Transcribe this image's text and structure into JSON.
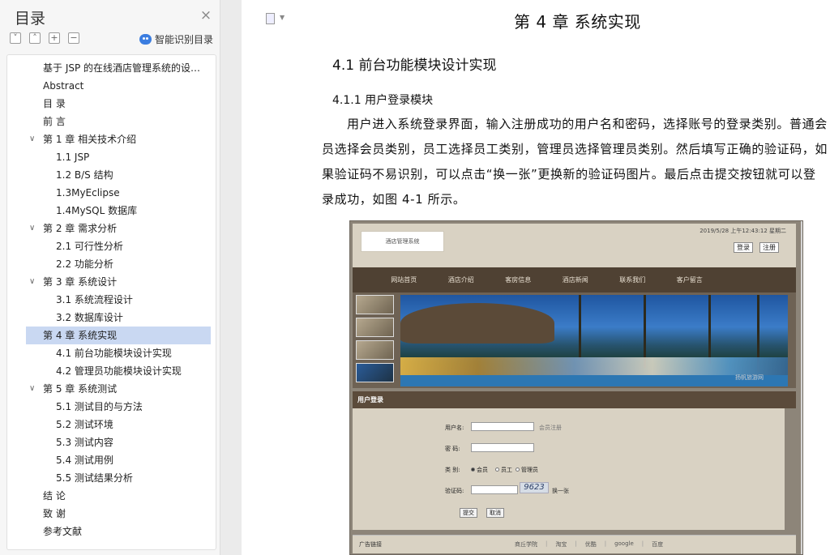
{
  "sidebar": {
    "title": "目录",
    "close_icon": "×",
    "tool_icons": [
      "collapse-all-icon",
      "expand-up-icon",
      "plus-icon",
      "minus-icon"
    ],
    "ai_button_label": "智能识别目录",
    "toc": [
      {
        "label": "基于 JSP 的在线酒店管理系统的设计与实现",
        "level": 0,
        "expandable": false
      },
      {
        "label": "Abstract",
        "level": 0,
        "expandable": false
      },
      {
        "label": "目 录",
        "level": 0,
        "expandable": false
      },
      {
        "label": "前 言",
        "level": 0,
        "expandable": false
      },
      {
        "label": "第 1 章 相关技术介绍",
        "level": 0,
        "expandable": true
      },
      {
        "label": "1.1 JSP",
        "level": 1,
        "expandable": false
      },
      {
        "label": "1.2  B/S 结构",
        "level": 1,
        "expandable": false
      },
      {
        "label": "1.3MyEclipse",
        "level": 1,
        "expandable": false
      },
      {
        "label": "1.4MySQL 数据库",
        "level": 1,
        "expandable": false
      },
      {
        "label": "第 2 章 需求分析",
        "level": 0,
        "expandable": true
      },
      {
        "label": "2.1 可行性分析",
        "level": 1,
        "expandable": false
      },
      {
        "label": "2.2 功能分析",
        "level": 1,
        "expandable": false
      },
      {
        "label": "第 3 章 系统设计",
        "level": 0,
        "expandable": true
      },
      {
        "label": "3.1 系统流程设计",
        "level": 1,
        "expandable": false
      },
      {
        "label": "3.2 数据库设计",
        "level": 1,
        "expandable": false
      },
      {
        "label": "第 4 章 系统实现",
        "level": 0,
        "expandable": true,
        "selected": true
      },
      {
        "label": "4.1  前台功能模块设计实现",
        "level": 1,
        "expandable": false
      },
      {
        "label": "4.2  管理员功能模块设计实现",
        "level": 1,
        "expandable": false
      },
      {
        "label": "第 5 章 系统测试",
        "level": 0,
        "expandable": true
      },
      {
        "label": "5.1 测试目的与方法",
        "level": 1,
        "expandable": false
      },
      {
        "label": "5.2 测试环境",
        "level": 1,
        "expandable": false
      },
      {
        "label": "5.3 测试内容",
        "level": 1,
        "expandable": false
      },
      {
        "label": "5.4 测试用例",
        "level": 1,
        "expandable": false
      },
      {
        "label": "5.5 测试结果分析",
        "level": 1,
        "expandable": false
      },
      {
        "label": "结 论",
        "level": 0,
        "expandable": false
      },
      {
        "label": "致 谢",
        "level": 0,
        "expandable": false
      },
      {
        "label": "参考文献",
        "level": 0,
        "expandable": false
      }
    ]
  },
  "document": {
    "chapter_title": "第 4 章 系统实现",
    "section_title": "4.1  前台功能模块设计实现",
    "subsection_title": "4.1.1  用户登录模块",
    "paragraph": "用户进入系统登录界面，输入注册成功的用户名和密码，选择账号的登录类别。普通会员选择会员类别，员工选择员工类别，管理员选择管理员类别。然后填写正确的验证码，如果验证码不易识别，可以点击“换一张”更换新的验证码图片。最后点击提交按钮就可以登录成功，如图 4-1 所示。"
  },
  "screenshot": {
    "logo_text": "酒店管理系统",
    "datetime": "2019/5/28 上午12:43:12  星期二",
    "login_btn": "登录",
    "register_btn": "注册",
    "nav": [
      "网站首页",
      "酒店介绍",
      "客房信息",
      "酒店新闻",
      "联系我们",
      "客户留言"
    ],
    "watermark": "扬帆旅游网",
    "login_header": "用户登录",
    "username_label": "用户名:",
    "member_register_hint": "会员注册",
    "password_label": "密  码:",
    "type_label": "类  别:",
    "type_options": [
      "会员",
      "员工",
      "管理员"
    ],
    "captcha_label": "验证码:",
    "captcha_value": "9623",
    "refresh_captcha": "换一张",
    "submit_btn": "提交",
    "cancel_btn": "取消",
    "footer_label": "广告链接",
    "footer_links": [
      "商丘学院",
      "淘宝",
      "优酷",
      "google",
      "百度"
    ]
  }
}
